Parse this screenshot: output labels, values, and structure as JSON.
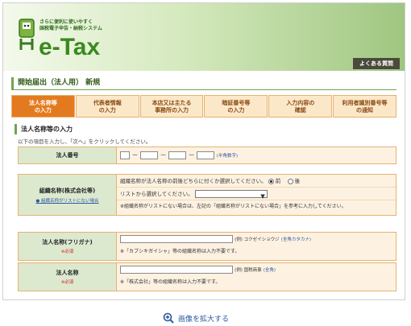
{
  "header": {
    "tagline_line1": "さらに便利に使いやすく",
    "tagline_line2": "国税電子申告・納税システム",
    "logo_text": "e-Tax",
    "faq_label": "よくある質問"
  },
  "page_title": "開始届出（法人用） 新規",
  "steps": [
    {
      "line1": "法人名称等",
      "line2": "の入力",
      "active": true
    },
    {
      "line1": "代表者情報",
      "line2": "の入力",
      "active": false
    },
    {
      "line1": "本店又は主たる",
      "line2": "事務所の入力",
      "active": false
    },
    {
      "line1": "暗証番号等",
      "line2": "の入力",
      "active": false
    },
    {
      "line1": "入力内容の",
      "line2": "確認",
      "active": false
    },
    {
      "line1": "利用者識別番号等",
      "line2": "の通知",
      "active": false
    }
  ],
  "section_title": "法人名称等の入力",
  "instruction": "以下の項目を入力し、「次へ」をクリックしてください。",
  "corp_number": {
    "label": "法人番号",
    "dash": "－",
    "hint": "(半角数字)"
  },
  "org_name": {
    "label": "組織名称(株式会社等)",
    "help_link": "組織名称がリストにない場合",
    "position_question": "組織名称が法人名称の前後どちらに付くか選択してください。",
    "option_before": "前",
    "option_after": "後",
    "select_prompt": "リストから選択してください。",
    "note": "※組織名称がリストにない場合は、左記の「組織名称がリストにない場合」を参考に入力してください。"
  },
  "name_kana": {
    "label": "法人名称(フリガナ)",
    "required": "※必須",
    "example": "(例) コクゼイショウジ",
    "format": "(全角カタカナ)",
    "note": "※「カブシキガイシャ」等の組織名称は入力不要です。"
  },
  "name": {
    "label": "法人名称",
    "required": "※必須",
    "example": "(例) 国税商事",
    "format": "(全角)",
    "note": "※「株式会社」等の組織名称は入力不要です。"
  },
  "footer": {
    "enlarge_label": "画像を拡大する"
  },
  "colors": {
    "accent_orange": "#e47a1f",
    "brand_green": "#3a8a1e",
    "label_bg": "#dce9cf",
    "field_bg": "#fdf2e2"
  }
}
